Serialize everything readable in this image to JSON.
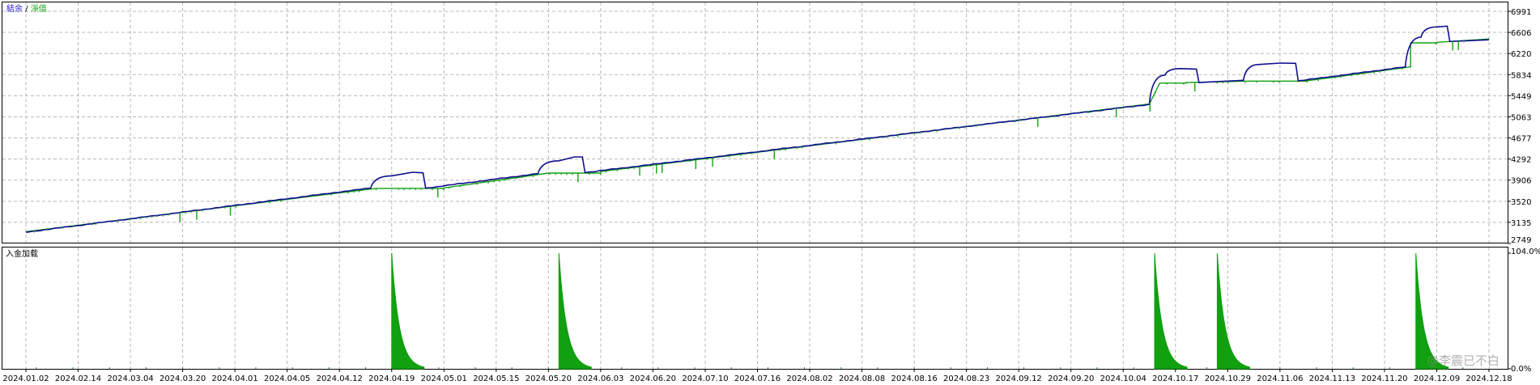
{
  "chart_data": [
    {
      "type": "line",
      "legend": {
        "series_a": "結余",
        "separator": " / ",
        "series_b": "淨值",
        "position": "top-left"
      },
      "x_ticks": [
        "2024.01.02",
        "2024.02.14",
        "2024.03.04",
        "2024.03.20",
        "2024.04.01",
        "2024.04.05",
        "2024.04.12",
        "2024.04.19",
        "2024.05.01",
        "2024.05.15",
        "2024.05.20",
        "2024.06.03",
        "2024.06.20",
        "2024.07.10",
        "2024.07.16",
        "2024.08.02",
        "2024.08.08",
        "2024.08.16",
        "2024.08.23",
        "2024.09.12",
        "2024.09.20",
        "2024.10.04",
        "2024.10.17",
        "2024.10.29",
        "2024.11.06",
        "2024.11.13",
        "2024.11.20",
        "2024.12.09",
        "2024.12.18"
      ],
      "y_ticks": [
        "6991",
        "6606",
        "6220",
        "5834",
        "5449",
        "5063",
        "4677",
        "4292",
        "3906",
        "3520",
        "3135",
        "2749"
      ],
      "ylim": [
        2749,
        6991
      ],
      "grid": true,
      "series": [
        {
          "name": "結余",
          "color": "#10a010",
          "points": [
            [
              0,
              2965
            ],
            [
              6.7,
              3755
            ],
            [
              6.7,
              3755
            ],
            [
              8.0,
              3755
            ],
            [
              8.0,
              3765
            ],
            [
              10.0,
              4035
            ],
            [
              10.0,
              4035
            ],
            [
              11.0,
              4035
            ],
            [
              11.0,
              4065
            ],
            [
              21.5,
              5297
            ],
            [
              21.7,
              5680
            ],
            [
              22.2,
              5680
            ],
            [
              22.2,
              5690
            ],
            [
              23.4,
              5715
            ],
            [
              23.4,
              5715
            ],
            [
              24.5,
              5715
            ],
            [
              24.5,
              5720
            ],
            [
              26.5,
              5975
            ],
            [
              26.5,
              6415
            ],
            [
              27.0,
              6415
            ],
            [
              27.0,
              6425
            ],
            [
              28.0,
              6485
            ]
          ]
        },
        {
          "name": "淨值",
          "color": "#101090",
          "points": [
            [
              0,
              2955
            ],
            [
              6.6,
              3762
            ],
            [
              7.0,
              3985
            ],
            [
              7.4,
              4050
            ],
            [
              7.6,
              4040
            ],
            [
              7.65,
              3760
            ],
            [
              9.8,
              4025
            ],
            [
              10.2,
              4260
            ],
            [
              10.5,
              4330
            ],
            [
              10.65,
              4330
            ],
            [
              10.7,
              4045
            ],
            [
              21.5,
              5290
            ],
            [
              21.8,
              5825
            ],
            [
              22.1,
              5945
            ],
            [
              22.4,
              5935
            ],
            [
              22.45,
              5690
            ],
            [
              23.3,
              5730
            ],
            [
              23.6,
              6020
            ],
            [
              24.0,
              6045
            ],
            [
              24.3,
              6040
            ],
            [
              24.35,
              5720
            ],
            [
              26.4,
              5975
            ],
            [
              26.7,
              6520
            ],
            [
              27.0,
              6705
            ],
            [
              27.2,
              6720
            ],
            [
              27.25,
              6440
            ],
            [
              28.0,
              6470
            ]
          ]
        }
      ]
    },
    {
      "type": "area",
      "title": "入金加载",
      "y_ticks": [
        "104.0%",
        "0.0%"
      ],
      "ylim": [
        0,
        104
      ],
      "color": "#10a010",
      "series": [
        {
          "name": "入金加载",
          "values": [
            [
              7.0,
              104
            ],
            [
              10.2,
              104
            ],
            [
              21.6,
              104
            ],
            [
              22.8,
              104
            ],
            [
              26.6,
              104
            ]
          ]
        }
      ]
    }
  ],
  "watermark": "@李震已不白"
}
